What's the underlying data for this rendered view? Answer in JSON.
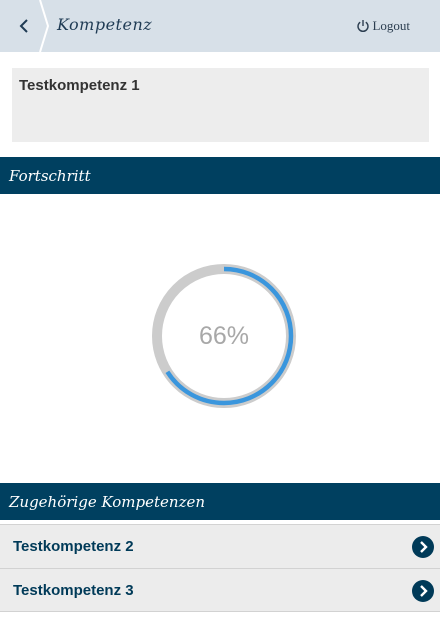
{
  "header": {
    "title": "Kompetenz",
    "logout_label": "Logout",
    "back_icon": "chevron-left-icon",
    "logout_icon": "power-icon"
  },
  "competence": {
    "title": "Testkompetenz 1"
  },
  "progress_section": {
    "heading": "Fortschritt",
    "percent_label": "66%",
    "fraction": 0.66
  },
  "related_section": {
    "heading": "Zugehörige Kompetenzen",
    "items": [
      {
        "label": "Testkompetenz 2",
        "icon": "chevron-right-circle-icon"
      },
      {
        "label": "Testkompetenz 3",
        "icon": "chevron-right-circle-icon"
      }
    ]
  },
  "colors": {
    "nav_bg": "#d7e0e8",
    "section_bg": "#004060",
    "progress_track": "#cccccc",
    "progress_fill": "#3a96dd",
    "list_text": "#003a58"
  }
}
